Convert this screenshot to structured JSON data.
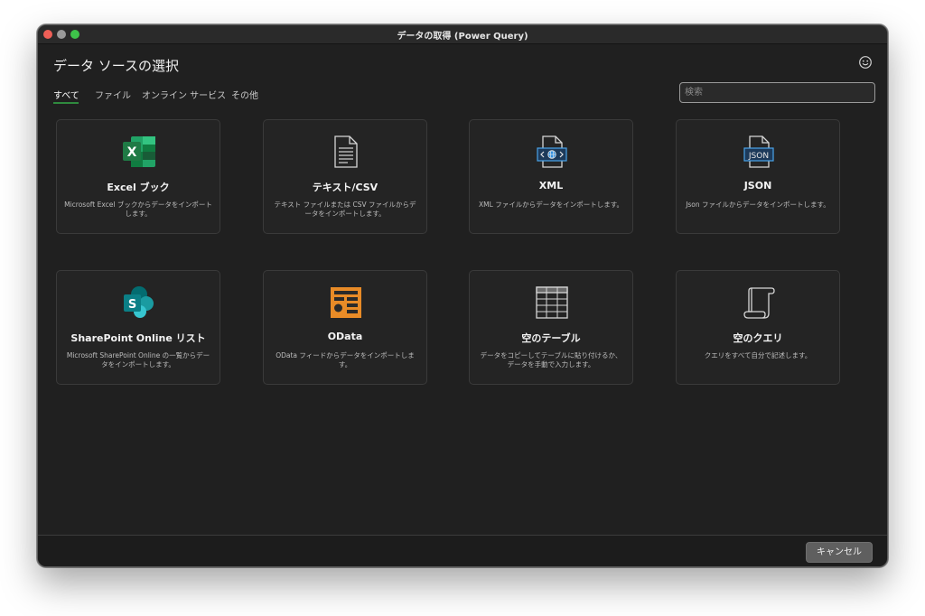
{
  "window": {
    "title": "データの取得 (Power Query)"
  },
  "page_title": "データ ソースの選択",
  "tabs": [
    {
      "label": "すべて",
      "active": true
    },
    {
      "label": "ファイル"
    },
    {
      "label": "オンライン サービス"
    },
    {
      "label": "その他"
    }
  ],
  "search": {
    "placeholder": "検索"
  },
  "tiles": [
    {
      "name": "Excel ブック",
      "desc": "Microsoft Excel ブックからデータをインポートします。",
      "icon": "excel-icon"
    },
    {
      "name": "テキスト/CSV",
      "desc": "テキスト ファイルまたは CSV ファイルからデータをインポートします。",
      "icon": "text-file-icon"
    },
    {
      "name": "XML",
      "desc": "XML ファイルからデータをインポートします。",
      "icon": "xml-file-icon"
    },
    {
      "name": "JSON",
      "desc": "Json ファイルからデータをインポートします。",
      "icon": "json-file-icon"
    },
    {
      "name": "SharePoint Online リスト",
      "desc": "Microsoft SharePoint Online の一覧からデータをインポートします。",
      "icon": "sharepoint-icon"
    },
    {
      "name": "OData",
      "desc": "OData フィードからデータをインポートします。",
      "icon": "odata-icon"
    },
    {
      "name": "空のテーブル",
      "desc": "データをコピーしてテーブルに貼り付けるか、データを手動で入力します。",
      "icon": "table-grid-icon"
    },
    {
      "name": "空のクエリ",
      "desc": "クエリをすべて自分で記述します。",
      "icon": "scroll-query-icon"
    }
  ],
  "icon_labels": {
    "json": "JSON",
    "excel": "X",
    "sharepoint": "S"
  },
  "footer": {
    "cancel_label": "キャンセル"
  },
  "colors": {
    "accent_underline": "#2f8a3e",
    "excel_green": "#1f7a45",
    "odata_orange": "#e88b27",
    "sharepoint_teal": "#0b7f86"
  }
}
